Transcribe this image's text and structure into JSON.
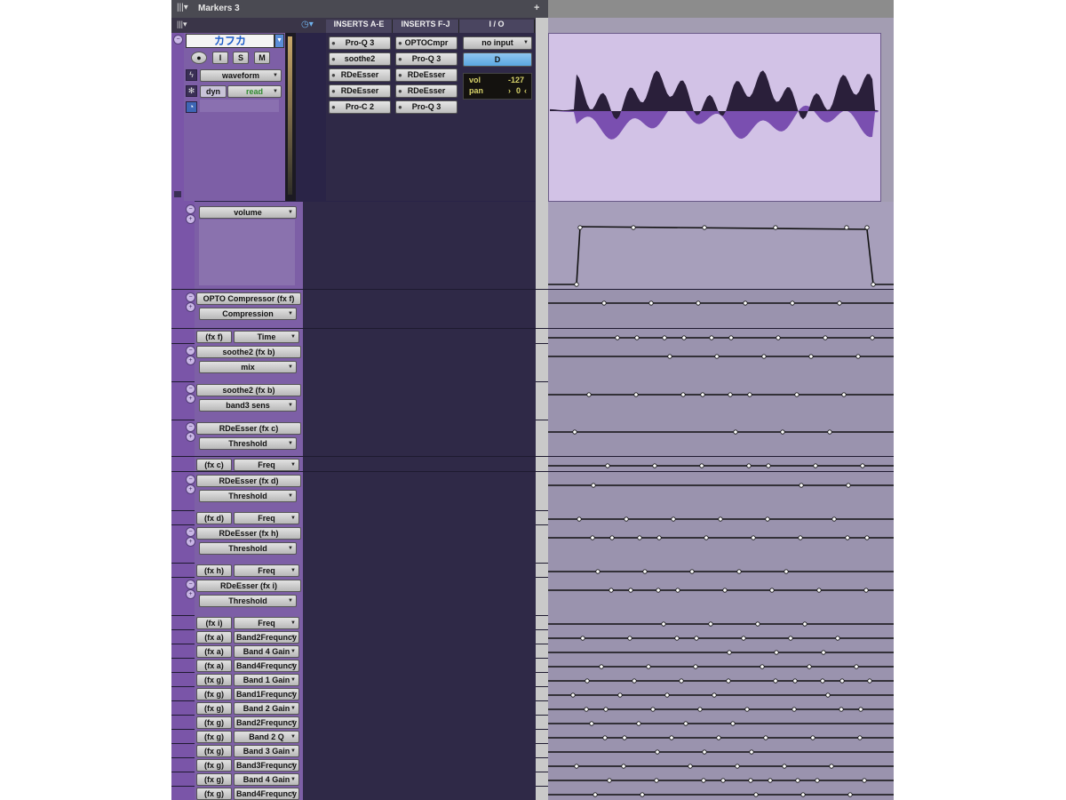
{
  "markers": {
    "label": "Markers 3",
    "plus": "+"
  },
  "header": {
    "inserts_ae": "INSERTS A-E",
    "inserts_fj": "INSERTS F-J",
    "io": "I / O"
  },
  "track": {
    "name": "カフカ",
    "buttons": {
      "record": "●",
      "input": "I",
      "solo": "S",
      "mute": "M"
    },
    "view": "waveform",
    "automation_mode": "read",
    "dyn": "dyn"
  },
  "inserts_ae": [
    "Pro-Q 3",
    "soothe2",
    "RDeEsser",
    "RDeEsser",
    "Pro-C 2"
  ],
  "inserts_fj": [
    "OPTOCmpr",
    "Pro-Q 3",
    "RDeEsser",
    "RDeEsser",
    "Pro-Q 3"
  ],
  "io": {
    "input": "no input",
    "output": "D"
  },
  "volpan": {
    "vol_label": "vol",
    "vol_value": "-127",
    "pan_label": "pan",
    "pan_value": "0"
  },
  "lanes": [
    {
      "plugin": "",
      "param": "volume"
    },
    {
      "plugin": "OPTO Compressor  (fx f)",
      "param": "Compression"
    },
    {
      "plugin": "(fx f)",
      "param": "Time"
    },
    {
      "plugin": "soothe2  (fx b)",
      "param": "mix"
    },
    {
      "plugin": "soothe2  (fx b)",
      "param": "band3 sens"
    },
    {
      "plugin": "RDeEsser  (fx c)",
      "param": "Threshold"
    },
    {
      "plugin": "(fx c)",
      "param": "Freq"
    },
    {
      "plugin": "RDeEsser  (fx d)",
      "param": "Threshold"
    },
    {
      "plugin": "(fx d)",
      "param": "Freq"
    },
    {
      "plugin": "RDeEsser  (fx h)",
      "param": "Threshold"
    },
    {
      "plugin": "(fx h)",
      "param": "Freq"
    },
    {
      "plugin": "RDeEsser  (fx i)",
      "param": "Threshold"
    },
    {
      "plugin": "(fx i)",
      "param": "Freq"
    },
    {
      "plugin": "(fx a)",
      "param": "Band2Frequncy"
    },
    {
      "plugin": "(fx a)",
      "param": "Band 4 Gain"
    },
    {
      "plugin": "(fx a)",
      "param": "Band4Frequncy"
    },
    {
      "plugin": "(fx g)",
      "param": "Band 1 Gain"
    },
    {
      "plugin": "(fx g)",
      "param": "Band1Frequncy"
    },
    {
      "plugin": "(fx g)",
      "param": "Band 2 Gain"
    },
    {
      "plugin": "(fx g)",
      "param": "Band2Frequncy"
    },
    {
      "plugin": "(fx g)",
      "param": "Band 2 Q"
    },
    {
      "plugin": "(fx g)",
      "param": "Band 3 Gain"
    },
    {
      "plugin": "(fx g)",
      "param": "Band3Frequncy"
    },
    {
      "plugin": "(fx g)",
      "param": "Band 4 Gain"
    },
    {
      "plugin": "(fx g)",
      "param": "Band4Frequncy"
    }
  ],
  "colors": {
    "track": "#7d5fa6",
    "timeline": "#9a93ae",
    "waveform": "#7a4fb0",
    "accent": "#5aa7e0"
  }
}
